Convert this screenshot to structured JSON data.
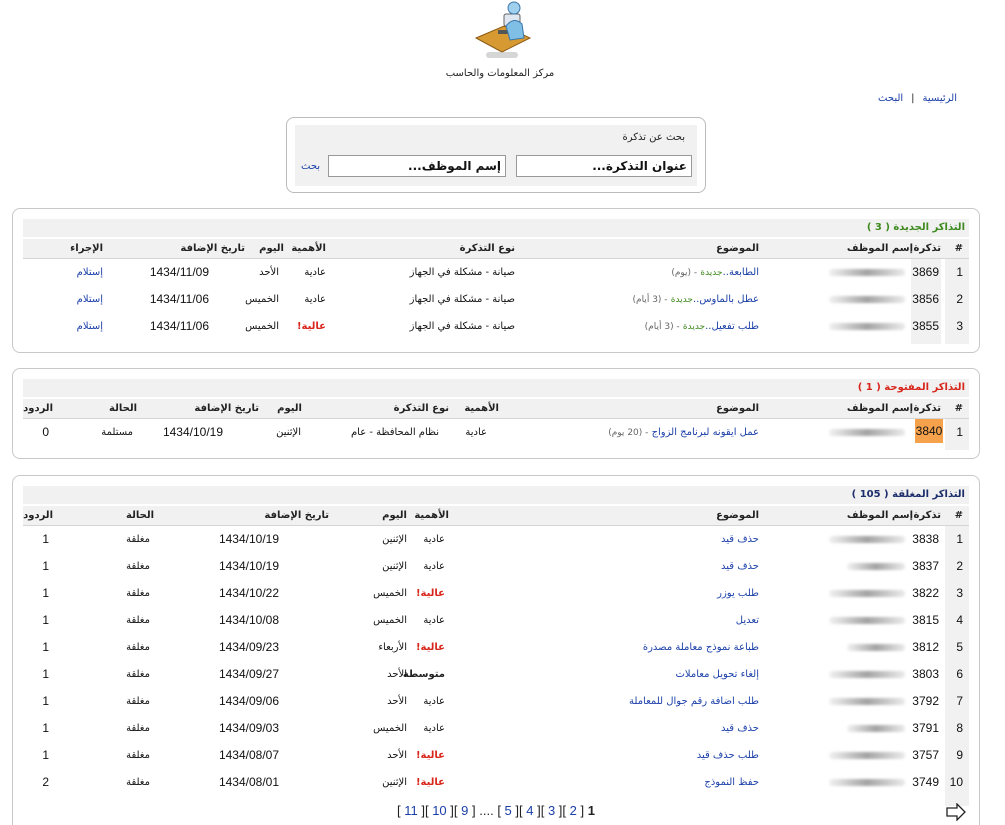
{
  "header": {
    "site_title": "مركز المعلومات والحاسب"
  },
  "topnav": {
    "home": "الرئيسية",
    "separator": "|",
    "search": "البحث"
  },
  "search": {
    "label": "بحث عن تذكرة",
    "title_placeholder": "عنوان التذكرة...",
    "name_placeholder": "إسم الموظف...",
    "button": "بحث"
  },
  "new_tickets": {
    "title": "التذاكر الجديدة",
    "count": "( 3 )",
    "headers": {
      "idx": "#",
      "ticket": "تذكرة",
      "employee": "إسم الموظف",
      "subject": "الموضوع",
      "type": "نوع التذكرة",
      "priority": "الأهمية",
      "day": "اليوم",
      "added": "تاريخ الإضافة",
      "action": "الإجراء"
    },
    "rows": [
      {
        "idx": "1",
        "ticket": "3869",
        "subject": "الطابعة..",
        "status": "جديدة",
        "age": "- (يوم)",
        "type": "صيانة - مشكلة في الجهاز",
        "priority": "عادية",
        "day": "الأحد",
        "date": "1434/11/09",
        "action": "إستلام"
      },
      {
        "idx": "2",
        "ticket": "3856",
        "subject": "عطل بالماوس..",
        "status": "جديدة",
        "age": "- (3 أيام)",
        "type": "صيانة - مشكلة في الجهاز",
        "priority": "عادية",
        "day": "الخميس",
        "date": "1434/11/06",
        "action": "إستلام"
      },
      {
        "idx": "3",
        "ticket": "3855",
        "subject": "طلب تفعيل..",
        "status": "جديدة",
        "age": "- (3 أيام)",
        "type": "صيانة - مشكلة في الجهاز",
        "priority": "عالية!",
        "day": "الخميس",
        "date": "1434/11/06",
        "action": "إستلام"
      }
    ]
  },
  "open_tickets": {
    "title": "التذاكر المفتوحة",
    "count": "( 1 )",
    "headers": {
      "idx": "#",
      "ticket": "تذكرة",
      "employee": "إسم الموظف",
      "subject": "الموضوع",
      "priority": "الأهمية",
      "type": "نوع التذكرة",
      "day": "اليوم",
      "added": "تاريخ الإضافة",
      "status": "الحالة",
      "replies": "الردود"
    },
    "rows": [
      {
        "idx": "1",
        "ticket": "3840",
        "subject": "عمل ايقونه لبرنامج الزواج",
        "age": "- (20 يوم)",
        "priority": "عادية",
        "type": "نظام المحافظة - عام",
        "day": "الإثنين",
        "date": "1434/10/19",
        "status": "مستلمة",
        "replies": "0"
      }
    ]
  },
  "closed_tickets": {
    "title": "التذاكر المغلقة",
    "count": "( 105 )",
    "headers": {
      "idx": "#",
      "ticket": "تذكرة",
      "employee": "إسم الموظف",
      "subject": "الموضوع",
      "priority": "الأهمية",
      "day": "اليوم",
      "added": "تاريخ الإضافة",
      "status": "الحالة",
      "replies": "الردود"
    },
    "rows": [
      {
        "idx": "1",
        "ticket": "3838",
        "subject": "حذف قيد",
        "priority": "عادية",
        "day": "الإثنين",
        "date": "1434/10/19",
        "status": "مغلقة",
        "replies": "1"
      },
      {
        "idx": "2",
        "ticket": "3837",
        "subject": "حذف قيد",
        "priority": "عادية",
        "day": "الإثنين",
        "date": "1434/10/19",
        "status": "مغلقة",
        "replies": "1"
      },
      {
        "idx": "3",
        "ticket": "3822",
        "subject": "طلب يوزر",
        "priority": "عالية!",
        "day": "الخميس",
        "date": "1434/10/22",
        "status": "مغلقة",
        "replies": "1"
      },
      {
        "idx": "4",
        "ticket": "3815",
        "subject": "تعديل",
        "priority": "عادية",
        "day": "الخميس",
        "date": "1434/10/08",
        "status": "مغلقة",
        "replies": "1"
      },
      {
        "idx": "5",
        "ticket": "3812",
        "subject": "طباعة نموذج معاملة مصدرة",
        "priority": "عالية!",
        "day": "الأربعاء",
        "date": "1434/09/23",
        "status": "مغلقة",
        "replies": "1"
      },
      {
        "idx": "6",
        "ticket": "3803",
        "subject": "إلغاء تحويل معاملات",
        "priority": "متوسطة",
        "day": "الأحد",
        "date": "1434/09/27",
        "status": "مغلقة",
        "replies": "1"
      },
      {
        "idx": "7",
        "ticket": "3792",
        "subject": "طلب اضافة رقم جوال للمعاملة",
        "priority": "عادية",
        "day": "الأحد",
        "date": "1434/09/06",
        "status": "مغلقة",
        "replies": "1"
      },
      {
        "idx": "8",
        "ticket": "3791",
        "subject": "حذف قيد",
        "priority": "عادية",
        "day": "الخميس",
        "date": "1434/09/03",
        "status": "مغلقة",
        "replies": "1"
      },
      {
        "idx": "9",
        "ticket": "3757",
        "subject": "طلب حذف قيد",
        "priority": "عالية!",
        "day": "الأحد",
        "date": "1434/08/07",
        "status": "مغلقة",
        "replies": "1"
      },
      {
        "idx": "10",
        "ticket": "3749",
        "subject": "حفظ النموذج",
        "priority": "عالية!",
        "day": "الإثنين",
        "date": "1434/08/01",
        "status": "مغلقة",
        "replies": "2"
      }
    ]
  },
  "pager": {
    "pages": [
      "11",
      "10",
      "9"
    ],
    "ellipsis": "....",
    "near": [
      "5",
      "4",
      "3",
      "2"
    ],
    "current": "1"
  },
  "colors": {
    "link": "#1a3fa8",
    "high": "#d8261b",
    "new_title": "#3f8a1f",
    "open_title": "#d8261b",
    "closed_title": "#1d2d6b",
    "highlight": "#f6a24d"
  }
}
